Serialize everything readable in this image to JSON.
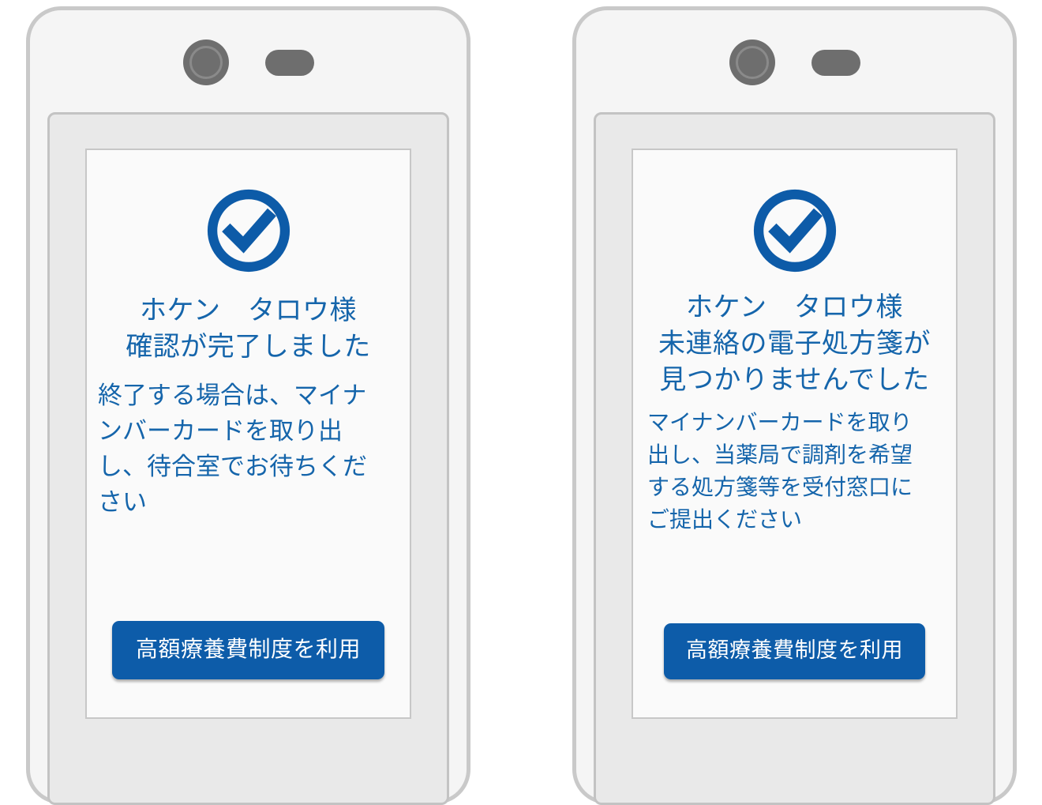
{
  "colors": {
    "accent_blue": "#0d5ca9",
    "text_blue": "#1565ab",
    "device_frame": "#c9c9c9",
    "device_body": "#f5f5f5",
    "screen_bg": "#e9e9e9",
    "card_bg": "#fafafa",
    "sensor_gray": "#6e6e6e",
    "button_text": "#ffffff"
  },
  "icons": {
    "camera": "camera-lens-icon",
    "speaker": "speaker-slot-icon",
    "check": "check-circle-icon"
  },
  "devices": [
    {
      "id": "left",
      "name": "confirmation-complete-terminal",
      "screen": {
        "status_icon": "check-circle-icon",
        "headline": "ホケン　タロウ様\n確認が完了しました",
        "body": "終了する場合は、マイナ\nンバーカードを取り出\nし、待合室でお待ちくだ\nさい",
        "button_label": "高額療養費制度を利用"
      }
    },
    {
      "id": "right",
      "name": "no-prescription-found-terminal",
      "screen": {
        "status_icon": "check-circle-icon",
        "headline": "ホケン　タロウ様\n未連絡の電子処方箋が\n見つかりませんでした",
        "body": "マイナンバーカードを取り\n出し、当薬局で調剤を希望\nする処方箋等を受付窓口に\nご提出ください",
        "button_label": "高額療養費制度を利用"
      }
    }
  ]
}
